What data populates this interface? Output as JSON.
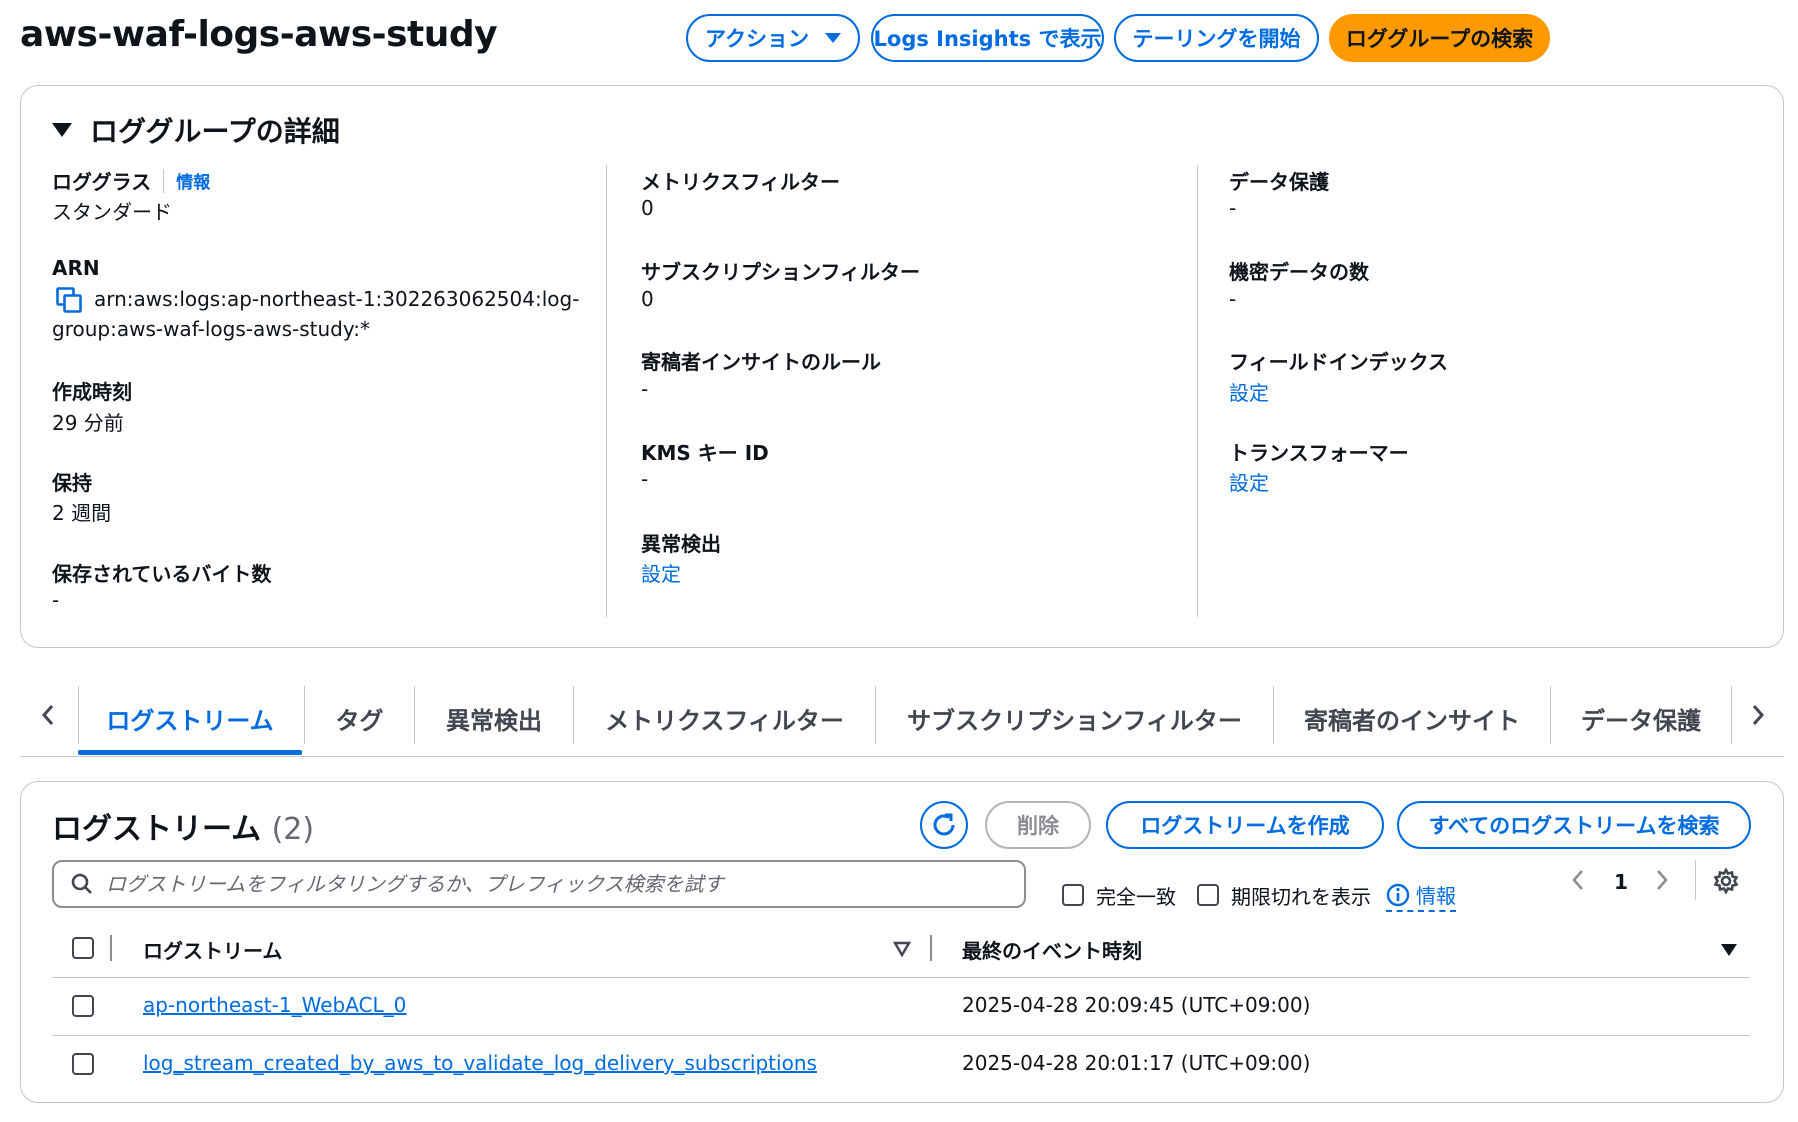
{
  "header": {
    "title": "aws-waf-logs-aws-study",
    "buttons": {
      "actions": "アクション",
      "logs_insights": "Logs Insights で表示",
      "tailing": "テーリングを開始",
      "search_log_group": "ロググループの検索"
    }
  },
  "details": {
    "title": "ロググループの詳細",
    "col1": {
      "log_class": {
        "label": "ロググラス",
        "info": "情報",
        "value": "スタンダード"
      },
      "arn": {
        "label": "ARN",
        "value_line1": "arn:aws:logs:ap-northeast-1:302263062504:log-",
        "value_line2": "group:aws-waf-logs-aws-study:*"
      },
      "created": {
        "label": "作成時刻",
        "value": "29 分前"
      },
      "retention": {
        "label": "保持",
        "value": "2 週間"
      },
      "stored_bytes": {
        "label": "保存されているバイト数",
        "value": "-"
      }
    },
    "col2": {
      "metric_filters": {
        "label": "メトリクスフィルター",
        "value": "0"
      },
      "subscription_filters": {
        "label": "サブスクリプションフィルター",
        "value": "0"
      },
      "contributor_rules": {
        "label": "寄稿者インサイトのルール",
        "value": "-"
      },
      "kms_key": {
        "label": "KMS キー ID",
        "value": "-"
      },
      "anomaly": {
        "label": "異常検出",
        "link": "設定"
      }
    },
    "col3": {
      "data_protection": {
        "label": "データ保護",
        "value": "-"
      },
      "sensitive_count": {
        "label": "機密データの数",
        "value": "-"
      },
      "field_index": {
        "label": "フィールドインデックス",
        "link": "設定"
      },
      "transformer": {
        "label": "トランスフォーマー",
        "link": "設定"
      }
    }
  },
  "tabs": [
    {
      "label": "ログストリーム",
      "active": true
    },
    {
      "label": "タグ"
    },
    {
      "label": "異常検出"
    },
    {
      "label": "メトリクスフィルター"
    },
    {
      "label": "サブスクリプションフィルター"
    },
    {
      "label": "寄稿者のインサイト"
    },
    {
      "label": "データ保護"
    }
  ],
  "streams": {
    "title": "ログストリーム",
    "count": "(2)",
    "buttons": {
      "delete": "削除",
      "create": "ログストリームを作成",
      "search_all": "すべてのログストリームを検索"
    },
    "search_placeholder": "ログストリームをフィルタリングするか、プレフィックス検索を試す",
    "options": {
      "exact_match": "完全一致",
      "show_expired": "期限切れを表示",
      "info": "情報"
    },
    "pager": {
      "page": "1"
    },
    "columns": {
      "stream": "ログストリーム",
      "last_event": "最終のイベント時刻"
    },
    "rows": [
      {
        "name": "ap-northeast-1_WebACL_0",
        "time": "2025-04-28 20:09:45 (UTC+09:00)"
      },
      {
        "name": "log_stream_created_by_aws_to_validate_log_delivery_subscriptions",
        "time": "2025-04-28 20:01:17 (UTC+09:00)"
      }
    ]
  },
  "colors": {
    "link": "#006ce0",
    "primary": "#ff9900",
    "text": "#0f141a",
    "border": "#c6c6cd"
  },
  "icons": [
    "chevron-left-icon",
    "chevron-right-icon",
    "copy-icon",
    "refresh-icon",
    "search-icon",
    "info-icon",
    "settings-icon",
    "sort-icon",
    "caret-down-icon"
  ]
}
